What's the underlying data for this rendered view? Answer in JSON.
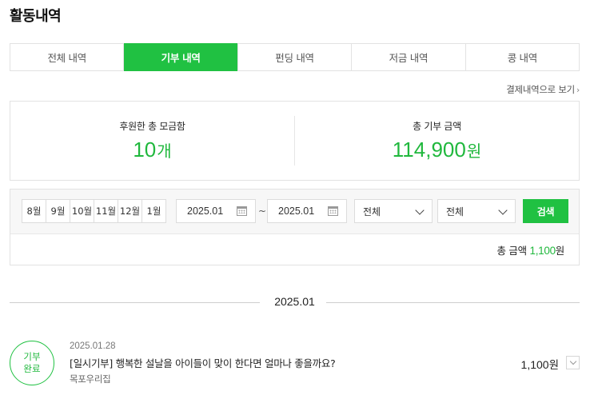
{
  "page": {
    "title": "활동내역"
  },
  "tabs": [
    {
      "label": "전체 내역",
      "active": false
    },
    {
      "label": "기부 내역",
      "active": true
    },
    {
      "label": "펀딩 내역",
      "active": false
    },
    {
      "label": "저금 내역",
      "active": false
    },
    {
      "label": "콩 내역",
      "active": false
    }
  ],
  "payment_link": {
    "label": "결제내역으로 보기",
    "icon": "chevron-right-icon"
  },
  "summary": {
    "total_count_label": "후원한 총 모금함",
    "total_count_value": "10",
    "total_count_unit": "개",
    "total_amount_label": "총 기부 금액",
    "total_amount_value": "114,900",
    "total_amount_unit": "원"
  },
  "filter": {
    "months": [
      "8월",
      "9월",
      "10월",
      "11월",
      "12월",
      "1월"
    ],
    "start_date": "2025.01",
    "end_date": "2025.01",
    "range_separator": "~",
    "select_1": "전체",
    "select_2": "전체",
    "search_label": "검색",
    "total_label": "총 금액",
    "total_amount": "1,100",
    "total_unit": "원"
  },
  "period_label": "2025.01",
  "items": [
    {
      "status_line1": "기부",
      "status_line2": "완료",
      "date": "2025.01.28",
      "title": "[일시기부] 행복한 설날을 아이들이 맞이 한다면 얼마나 좋을까요?",
      "org": "목포우리집",
      "amount": "1,100",
      "unit": "원"
    }
  ],
  "colors": {
    "accent": "#20c142",
    "accent_text": "#20b83d",
    "border": "#e2e2e2"
  }
}
